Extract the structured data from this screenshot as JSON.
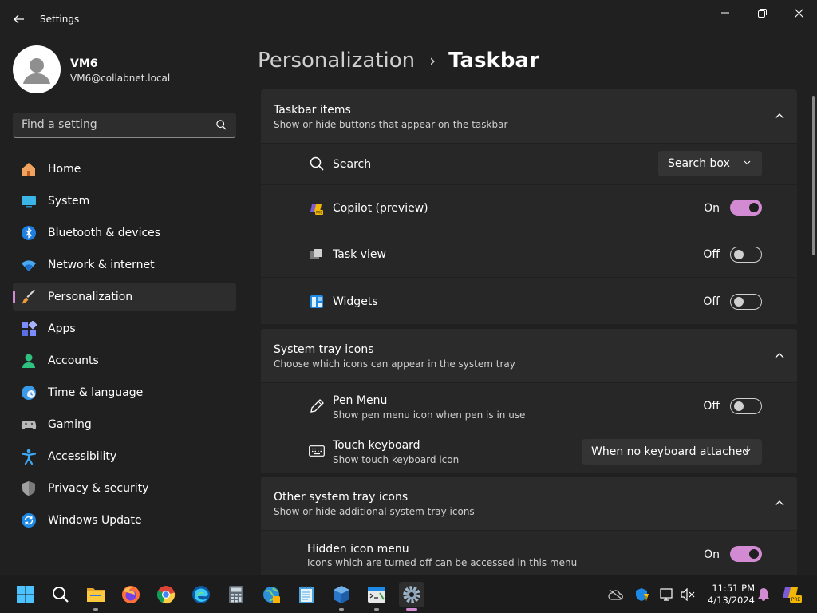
{
  "window": {
    "title": "Settings"
  },
  "user": {
    "name": "VM6",
    "email": "VM6@collabnet.local"
  },
  "search": {
    "placeholder": "Find a setting"
  },
  "sidebar": {
    "items": [
      {
        "label": "Home",
        "icon": "home-icon"
      },
      {
        "label": "System",
        "icon": "system-icon"
      },
      {
        "label": "Bluetooth & devices",
        "icon": "bluetooth-icon"
      },
      {
        "label": "Network & internet",
        "icon": "wifi-icon"
      },
      {
        "label": "Personalization",
        "icon": "brush-icon",
        "active": true
      },
      {
        "label": "Apps",
        "icon": "apps-icon"
      },
      {
        "label": "Accounts",
        "icon": "person-icon"
      },
      {
        "label": "Time & language",
        "icon": "clock-globe-icon"
      },
      {
        "label": "Gaming",
        "icon": "gamepad-icon"
      },
      {
        "label": "Accessibility",
        "icon": "accessibility-icon"
      },
      {
        "label": "Privacy & security",
        "icon": "shield-icon"
      },
      {
        "label": "Windows Update",
        "icon": "update-icon"
      }
    ]
  },
  "breadcrumb": {
    "parent": "Personalization",
    "current": "Taskbar"
  },
  "sections": {
    "taskbar_items": {
      "title": "Taskbar items",
      "subtitle": "Show or hide buttons that appear on the taskbar",
      "rows": {
        "search": {
          "label": "Search",
          "value": "Search box"
        },
        "copilot": {
          "label": "Copilot (preview)",
          "state": "On"
        },
        "task_view": {
          "label": "Task view",
          "state": "Off"
        },
        "widgets": {
          "label": "Widgets",
          "state": "Off"
        }
      }
    },
    "system_tray": {
      "title": "System tray icons",
      "subtitle": "Choose which icons can appear in the system tray",
      "rows": {
        "pen_menu": {
          "label": "Pen Menu",
          "desc": "Show pen menu icon when pen is in use",
          "state": "Off"
        },
        "touch_keyboard": {
          "label": "Touch keyboard",
          "desc": "Show touch keyboard icon",
          "value": "When no keyboard attached"
        }
      }
    },
    "other_tray": {
      "title": "Other system tray icons",
      "subtitle": "Show or hide additional system tray icons",
      "rows": {
        "hidden_icon_menu": {
          "label": "Hidden icon menu",
          "desc": "Icons which are turned off can be accessed in this menu",
          "state": "On"
        }
      }
    }
  },
  "taskbar": {
    "apps": [
      "start-icon",
      "search-icon",
      "file-explorer-icon",
      "firefox-icon",
      "chrome-icon",
      "edge-icon",
      "calculator-icon",
      "globe-app-icon",
      "notepad-icon",
      "virtualbox-icon",
      "terminal-icon",
      "settings-icon"
    ],
    "tray": [
      "cloud-icon",
      "defender-icon",
      "display-icon",
      "volume-muted-icon"
    ],
    "time": "11:51 PM",
    "date": "4/13/2024"
  },
  "colors": {
    "accent": "#d28ad2",
    "background": "#202020",
    "card": "#2b2b2b"
  }
}
